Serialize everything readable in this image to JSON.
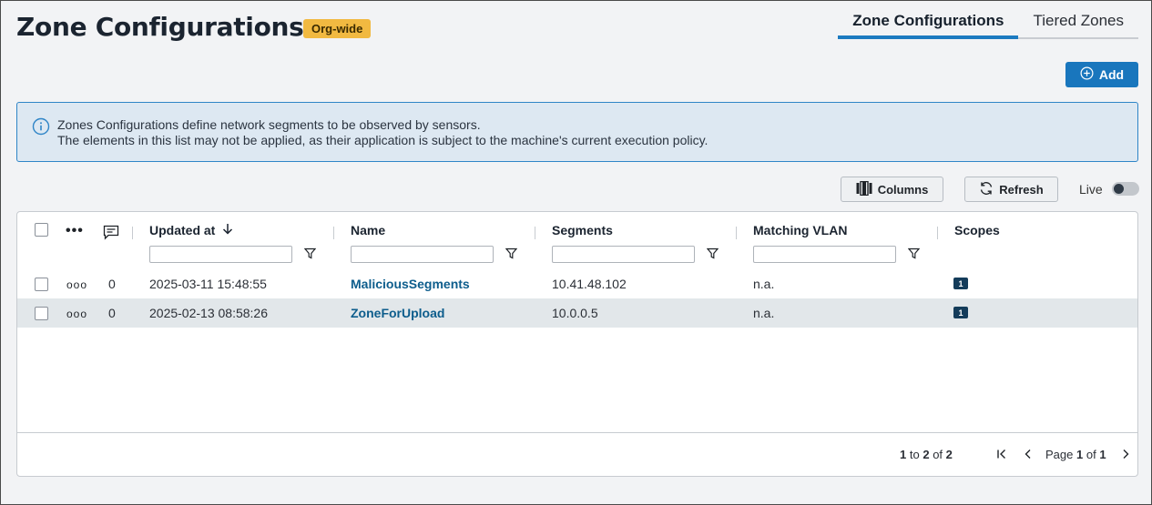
{
  "header": {
    "title": "Zone Configurations",
    "badge": "Org-wide"
  },
  "tabs": [
    {
      "label": "Zone Configurations",
      "active": true
    },
    {
      "label": "Tiered Zones",
      "active": false
    }
  ],
  "actions": {
    "add_label": "Add"
  },
  "info": {
    "line1": "Zones Configurations define network segments to be observed by sensors.",
    "line2": "The elements in this list may not be applied, as their application is subject to the machine's current execution policy."
  },
  "toolbar": {
    "columns_label": "Columns",
    "refresh_label": "Refresh",
    "live_label": "Live",
    "live_on": false
  },
  "table": {
    "columns": [
      "Updated at",
      "Name",
      "Segments",
      "Matching VLAN",
      "Scopes"
    ],
    "sort": {
      "column": "Updated at",
      "direction": "desc"
    },
    "rows": [
      {
        "comments": "0",
        "updated_at": "2025-03-11 15:48:55",
        "name": "MaliciousSegments",
        "segments": "10.41.48.102",
        "vlan": "n.a.",
        "scopes": "1"
      },
      {
        "comments": "0",
        "updated_at": "2025-02-13 08:58:26",
        "name": "ZoneForUpload",
        "segments": "10.0.0.5",
        "vlan": "n.a.",
        "scopes": "1"
      }
    ]
  },
  "pagination": {
    "from": "1",
    "to_word": "to",
    "to": "2",
    "of_word": "of",
    "total": "2",
    "page_word": "Page",
    "page": "1",
    "page_of_word": "of",
    "pages": "1"
  },
  "colors": {
    "accent": "#1976bd",
    "badge": "#f1b941",
    "info_bg": "#dde8f2",
    "info_border": "#2f85c7",
    "link": "#0d5d8c",
    "selected_row": "#e2e7ea"
  }
}
